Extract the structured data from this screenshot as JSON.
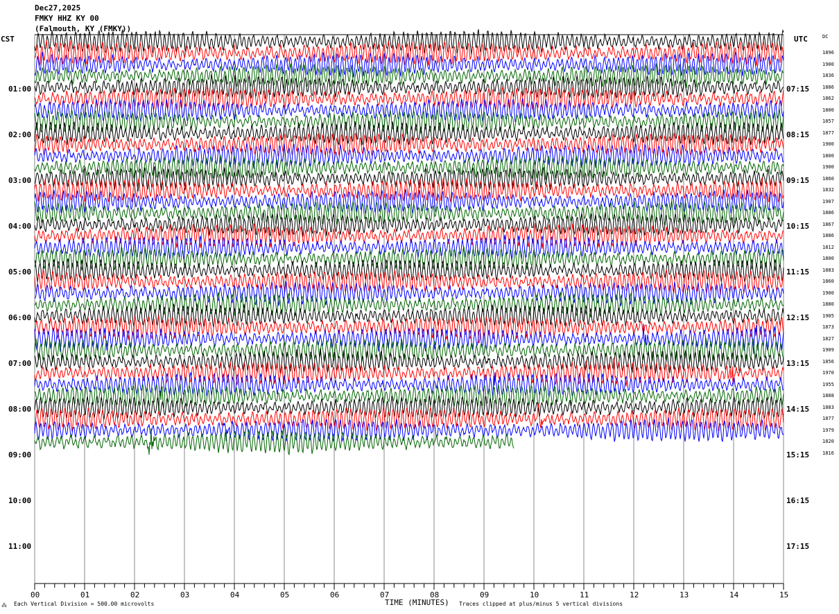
{
  "header": {
    "date": "Dec27,2025",
    "channel": "FMKY HHZ KY 00",
    "location": "(Falmouth, KY (FMKY))"
  },
  "left_tz": "CST",
  "right_tz": "UTC",
  "dc_label": "DC",
  "chart_data": {
    "type": "line",
    "title": "FMKY HHZ KY 00 helicorder Dec27,2025",
    "xlabel": "TIME (MINUTES)",
    "x_ticks": [
      "00",
      "01",
      "02",
      "03",
      "04",
      "05",
      "06",
      "07",
      "08",
      "09",
      "10",
      "11",
      "12",
      "13",
      "14",
      "15"
    ],
    "xlim": [
      0,
      15
    ],
    "left_hour_labels": [
      "01:00",
      "02:00",
      "03:00",
      "04:00",
      "05:00",
      "06:00",
      "07:00",
      "08:00",
      "09:00",
      "10:00",
      "11:00"
    ],
    "right_hour_labels": [
      "07:15",
      "08:15",
      "09:15",
      "10:15",
      "11:15",
      "12:15",
      "13:15",
      "14:15",
      "15:15",
      "16:15",
      "17:15"
    ],
    "trace_minutes": 15,
    "trace_count": 36,
    "last_trace_end_minute": 9.6,
    "trace_colors": [
      "#000000",
      "#ff0000",
      "#0000ff",
      "#006400"
    ],
    "dc_offsets": [
      1896,
      1900,
      1836,
      1886,
      1862,
      1800,
      1857,
      1877,
      1900,
      1800,
      1900,
      1860,
      1832,
      1907,
      1886,
      1867,
      1886,
      1812,
      1800,
      1883,
      1860,
      1900,
      1880,
      1905,
      1873,
      1827,
      1909,
      1856,
      1970,
      1955,
      1888,
      1883,
      1877,
      1979,
      1820,
      1816
    ],
    "events": [
      {
        "trace": 25,
        "minute": 8.9
      },
      {
        "trace": 26,
        "minute": 12.2
      },
      {
        "trace": 26,
        "minute": 14.4
      },
      {
        "trace": 29,
        "minute": 11.6
      },
      {
        "trace": 29,
        "minute": 13.9
      },
      {
        "trace": 30,
        "minute": 9.2
      },
      {
        "trace": 31,
        "minute": 2.5
      },
      {
        "trace": 33,
        "minute": 10.1
      },
      {
        "trace": 35,
        "minute": 2.3
      },
      {
        "trace": 34,
        "minute": 3.8
      }
    ],
    "scale_note": "Each Vertical Division =  500.00 microvolts",
    "clip_note": "Traces clipped at plus/minus 5 vertical divisions"
  }
}
